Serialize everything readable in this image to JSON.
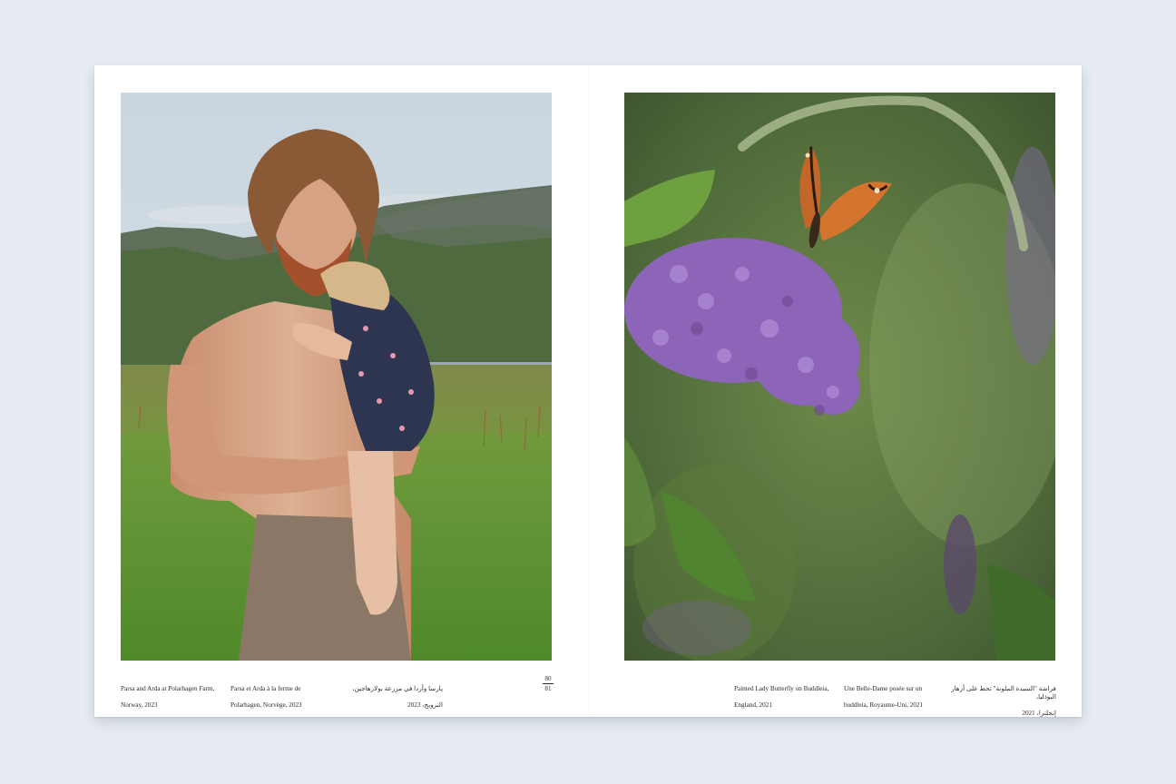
{
  "spread": {
    "left_page": {
      "photo_subject": "man-holding-child-in-field",
      "captions": {
        "en": [
          "Parsa and Arda at Polarhagen Farm,",
          "Norway, 2023"
        ],
        "fr": [
          "Parsa et Arda à la ferme de",
          "Polarhagen, Norvège, 2023"
        ],
        "ar": [
          "پارسا وأردا في مزرعة بولارهاجين،",
          "النرويج، 2023"
        ]
      },
      "page_numbers": [
        "80",
        "81"
      ]
    },
    "right_page": {
      "photo_subject": "butterfly-on-buddleia",
      "captions": {
        "en": [
          "Painted Lady Butterfly on Buddleia,",
          "England, 2021"
        ],
        "fr": [
          "Une Belle-Dame posée sur un",
          "buddleia, Royaume-Uni, 2021"
        ],
        "ar": [
          "فراشة \"السيدة الملونة\" تحط على أزهار البوذليا،",
          "إنجلترا، 2021"
        ]
      }
    }
  },
  "colors": {
    "background": "#e8ecf2",
    "paper": "#ffffff",
    "caption_text": "#2a2a2a"
  }
}
